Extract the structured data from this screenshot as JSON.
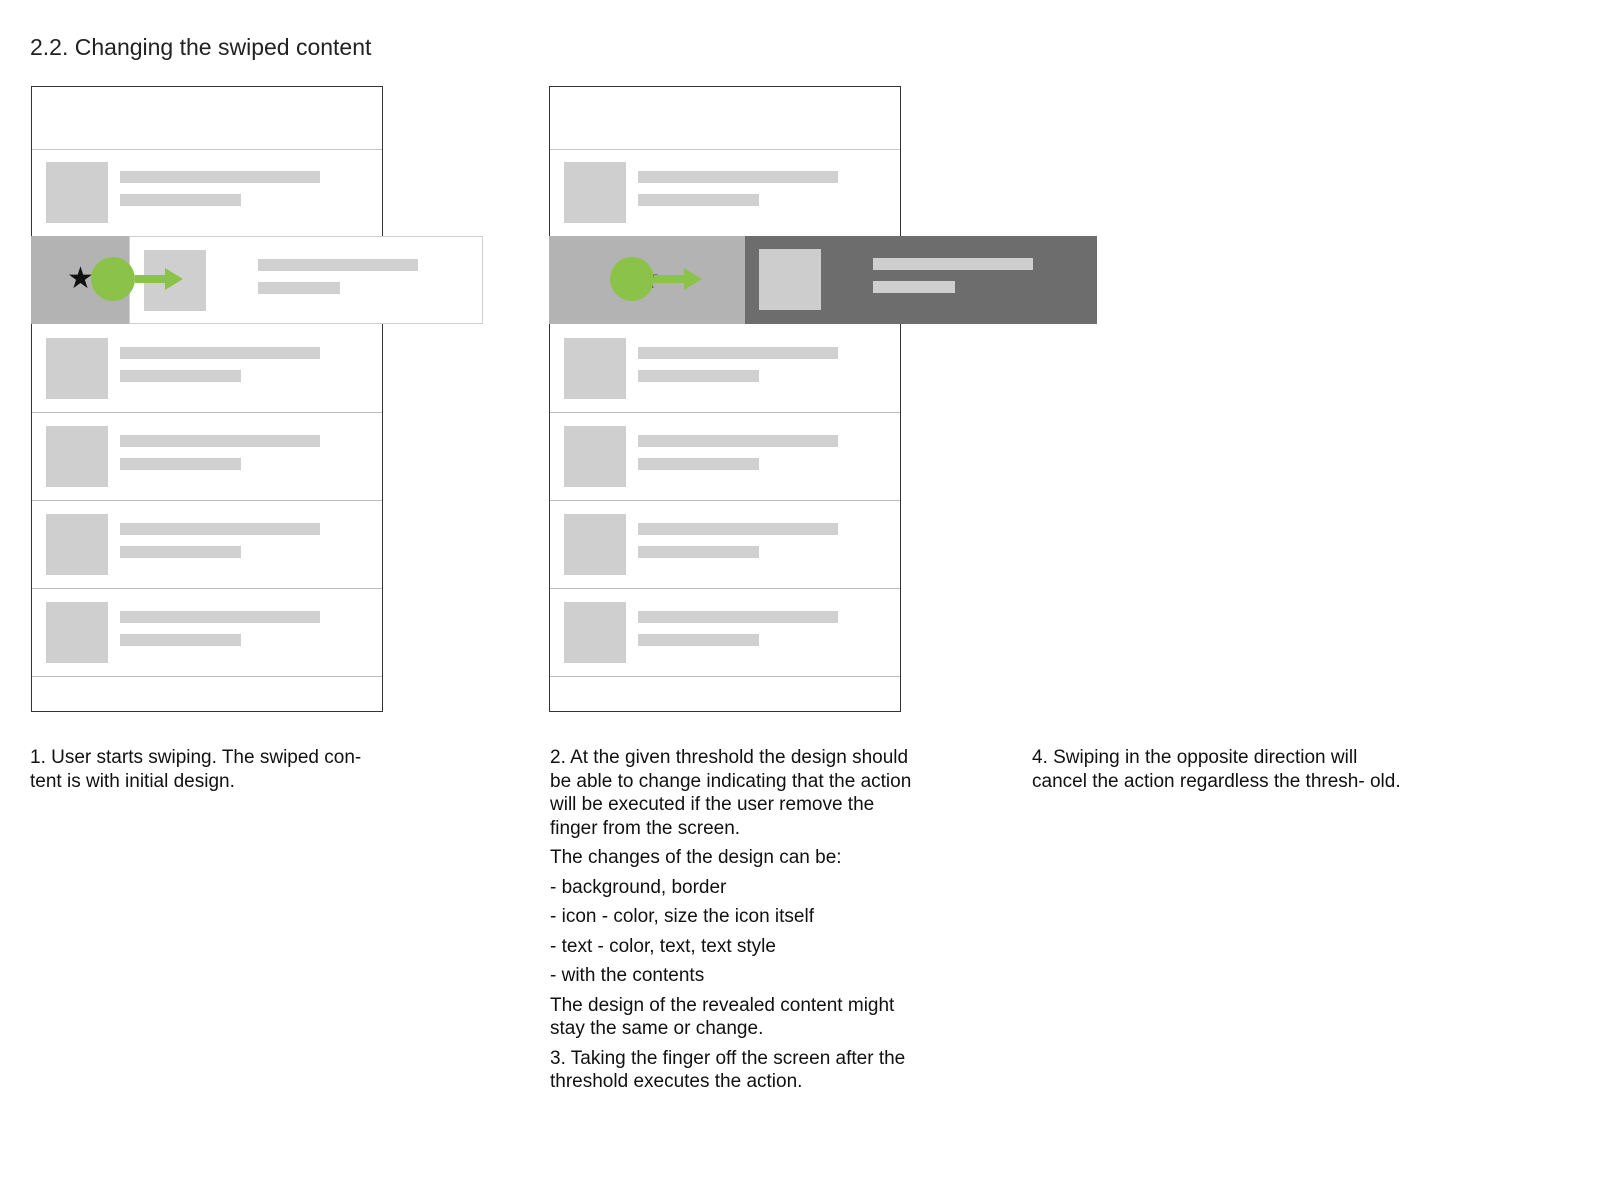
{
  "title": "2.2. Changing the swiped content",
  "icons": {
    "action": "star-icon",
    "gesture": "touch-point-icon",
    "direction": "arrow-right-icon"
  },
  "colors": {
    "accent": "#8bc34a",
    "reveal_bg": "#b3b3b3",
    "active_card_bg": "#6d6d6d",
    "placeholder": "#d0d0d0"
  },
  "star_glyph": "★",
  "captions": {
    "step1": "1. User starts swiping. The swiped con- tent is with initial design.",
    "step2_p1": "2. At the given threshold the design should be able to change indicating that the action will be executed if the user remove the finger from the screen.",
    "step2_p2": "The changes of the design can be:",
    "step2_items": [
      "- background, border",
      "- icon - color, size the icon itself",
      "- text - color, text, text style",
      "- with the contents"
    ],
    "step2_p3": "The design of the revealed content might stay the same or change.",
    "step3": "3. Taking the finger off the screen after the threshold executes the action.",
    "step4": "4. Swiping in the opposite direction will cancel the action regardless the thresh- old."
  }
}
